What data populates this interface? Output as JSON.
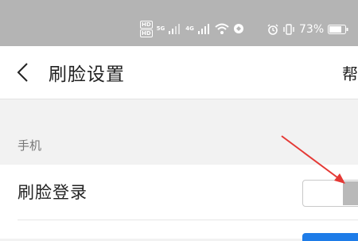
{
  "status_bar": {
    "hd_badges": [
      "HD",
      "HD"
    ],
    "net_5g": "5G",
    "net_4g": "4G",
    "battery_pct": "73%",
    "icons": [
      "signal-5g-icon",
      "signal-4g-icon",
      "wifi-icon",
      "sync-icon",
      "alarm-icon",
      "vibrate-icon",
      "battery-icon"
    ]
  },
  "header": {
    "title": "刷脸设置",
    "help": "帮"
  },
  "section": {
    "label": "手机"
  },
  "settings": [
    {
      "label": "刷脸登录",
      "state": "off"
    }
  ],
  "colors": {
    "status_bar": "#b4b4b4",
    "toggle_on": "#1e7ce8",
    "annotation_arrow": "#e53935"
  }
}
